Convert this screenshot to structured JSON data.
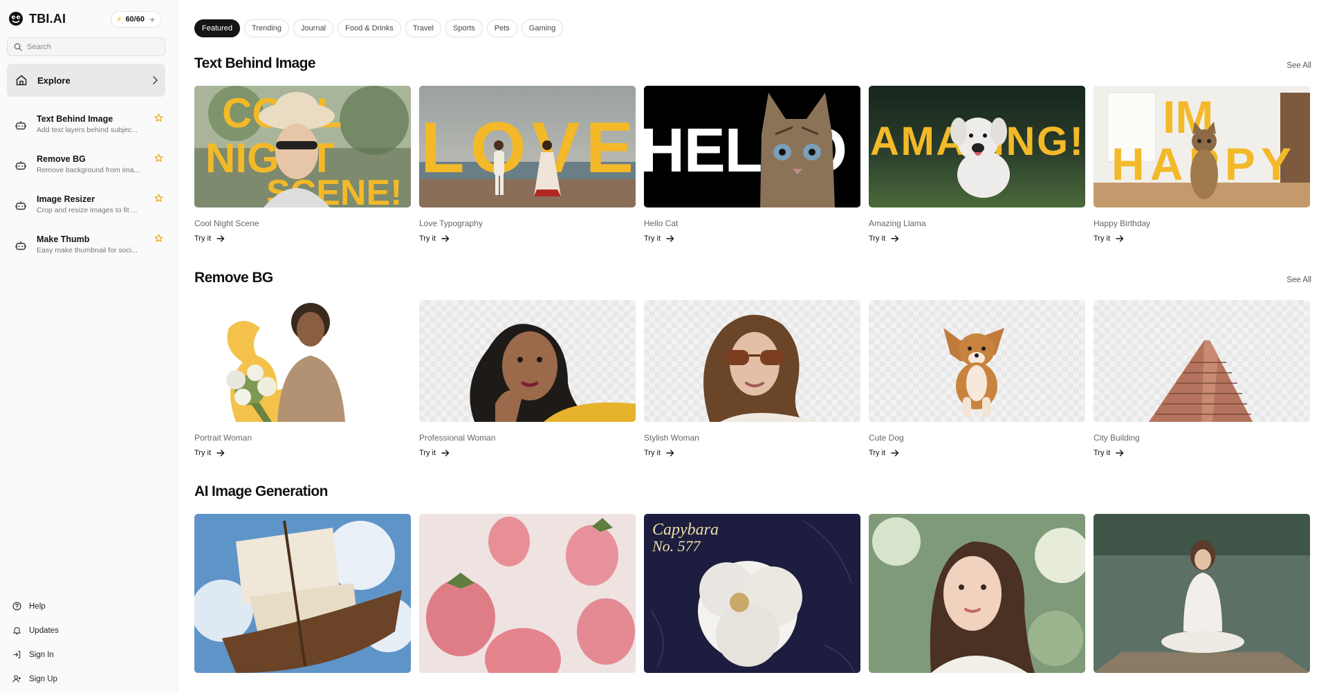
{
  "brand": {
    "name": "TBI.AI",
    "credits": "60/60"
  },
  "search": {
    "placeholder": "Search"
  },
  "sidebar": {
    "explore_label": "Explore",
    "tools": [
      {
        "name": "Text Behind Image",
        "desc": "Add text layers behind subjec..."
      },
      {
        "name": "Remove BG",
        "desc": "Remove background from ima..."
      },
      {
        "name": "Image Resizer",
        "desc": "Crop and resize images to fit ..."
      },
      {
        "name": "Make Thumb",
        "desc": "Easy make thumbnail for soci..."
      }
    ],
    "links": [
      {
        "label": "Help",
        "icon": "help-circle-icon"
      },
      {
        "label": "Updates",
        "icon": "bell-icon"
      },
      {
        "label": "Sign In",
        "icon": "sign-in-icon"
      },
      {
        "label": "Sign Up",
        "icon": "user-plus-icon"
      }
    ]
  },
  "categories": [
    "Featured",
    "Trending",
    "Journal",
    "Food & Drinks",
    "Travel",
    "Sports",
    "Pets",
    "Gaming"
  ],
  "active_category": "Featured",
  "sections": [
    {
      "title": "Text Behind Image",
      "see_all": "See All",
      "cards": [
        {
          "title": "Cool Night Scene",
          "cta": "Try it"
        },
        {
          "title": "Love Typography",
          "cta": "Try it"
        },
        {
          "title": "Hello Cat",
          "cta": "Try it"
        },
        {
          "title": "Amazing Llama",
          "cta": "Try it"
        },
        {
          "title": "Happy Birthday",
          "cta": "Try it"
        }
      ]
    },
    {
      "title": "Remove BG",
      "see_all": "See All",
      "cards": [
        {
          "title": "Portrait Woman",
          "cta": "Try it"
        },
        {
          "title": "Professional Woman",
          "cta": "Try it"
        },
        {
          "title": "Stylish Woman",
          "cta": "Try it"
        },
        {
          "title": "Cute Dog",
          "cta": "Try it"
        },
        {
          "title": "City Building",
          "cta": "Try it"
        }
      ]
    },
    {
      "title": "AI Image Generation",
      "cards": []
    }
  ],
  "thumb_text": {
    "cool": [
      "COOL",
      "NIGHT",
      "SCENE!"
    ],
    "love": "LOVE",
    "hello": "HELLO",
    "amazing": "AMAZING!",
    "happy": [
      "IM",
      "HAPPY"
    ],
    "capybara": [
      "Capybara",
      "No. 577"
    ]
  },
  "colors": {
    "accent_yellow": "#f3b928",
    "dark": "#151515"
  }
}
